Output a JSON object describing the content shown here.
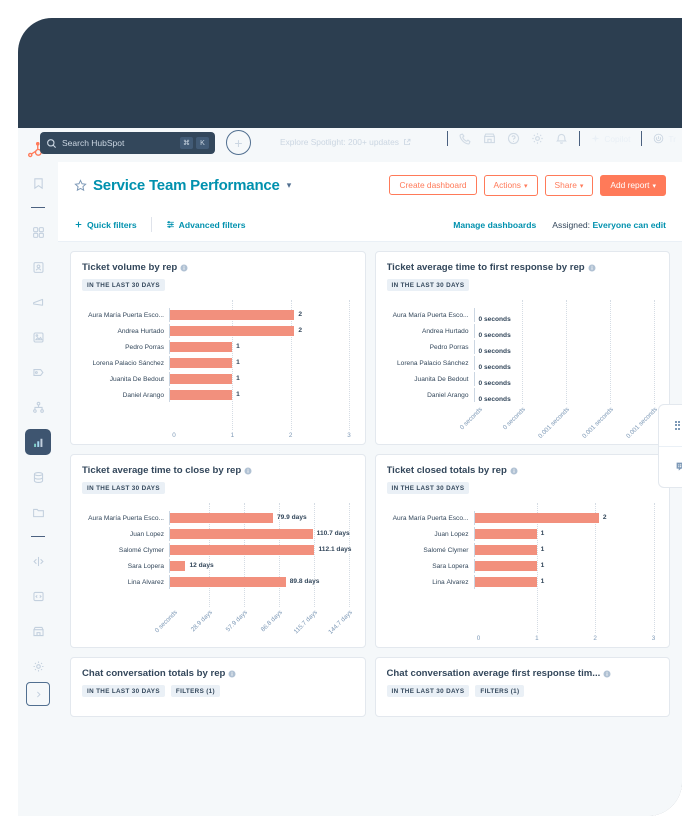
{
  "topnav": {
    "search_placeholder": "Search HubSpot",
    "search_icon": "search-icon",
    "kbd": [
      "⌘",
      "K"
    ],
    "plus_label": "+",
    "spotlight_text": "Explore Spotlight: 200+ updates",
    "external_icon": "external-link-icon",
    "icons": [
      "phone-icon",
      "marketplace-icon",
      "help-icon",
      "settings-icon",
      "notifications-icon"
    ],
    "copilot_label": "Copilot",
    "copilot_icon": "sparkle-icon",
    "account_label": "Tr",
    "account_icon": "account-icon"
  },
  "sidebar": {
    "logo": "hubspot-logo",
    "items": [
      {
        "name": "bookmarks",
        "icon": "bookmark-icon",
        "active": false
      },
      {
        "name": "workspaces",
        "icon": "grid-icon",
        "active": false
      },
      {
        "name": "contacts",
        "icon": "contacts-icon",
        "active": false
      },
      {
        "name": "marketing",
        "icon": "megaphone-icon",
        "active": false
      },
      {
        "name": "content",
        "icon": "content-icon",
        "active": false
      },
      {
        "name": "commerce",
        "icon": "tag-icon",
        "active": false
      },
      {
        "name": "automations",
        "icon": "workflow-icon",
        "active": false
      },
      {
        "name": "reporting",
        "icon": "bar-chart-icon",
        "active": true
      },
      {
        "name": "data-management",
        "icon": "database-icon",
        "active": false
      },
      {
        "name": "library",
        "icon": "folder-icon",
        "active": false
      },
      {
        "name": "integrations",
        "icon": "connect-icon",
        "active": false
      },
      {
        "name": "developer",
        "icon": "code-icon",
        "active": false
      },
      {
        "name": "app-marketplace",
        "icon": "marketplace-icon",
        "active": false
      },
      {
        "name": "settings",
        "icon": "gear-icon",
        "active": false
      }
    ],
    "expand_icon": "expand-right-icon"
  },
  "dashboard": {
    "title": "Service Team Performance",
    "star_icon": "star-outline-icon",
    "title_caret": "▾",
    "buttons": {
      "create": "Create dashboard",
      "actions": "Actions",
      "share": "Share",
      "add_report": "Add report",
      "caret": "▾"
    },
    "filters": {
      "quick": "Quick filters",
      "quick_icon": "plus-icon",
      "advanced": "Advanced filters",
      "advanced_icon": "filter-icon",
      "manage": "Manage dashboards",
      "assigned_label": "Assigned:",
      "assigned_value": "Everyone can edit"
    }
  },
  "chart_data": [
    {
      "type": "bar",
      "orientation": "horizontal",
      "title": "Ticket volume by rep",
      "badges": [
        "IN THE LAST 30 DAYS"
      ],
      "categories": [
        "Aura María Puerta Esco...",
        "Andrea Hurtado",
        "Pedro Porras",
        "Lorena Palacio Sánchez",
        "Juanita De Bedout",
        "Daniel Arango"
      ],
      "values": [
        2,
        2,
        1,
        1,
        1,
        1
      ],
      "value_labels": [
        "2",
        "2",
        "1",
        "1",
        "1",
        "1"
      ],
      "ticks": [
        "0",
        "1",
        "2",
        "3"
      ],
      "xlim": [
        0,
        3
      ],
      "grid": true,
      "bar_color": "#F2907D"
    },
    {
      "type": "bar",
      "orientation": "horizontal",
      "title": "Ticket average time to first response by rep",
      "badges": [
        "IN THE LAST 30 DAYS"
      ],
      "categories": [
        "Aura María Puerta Esco...",
        "Andrea Hurtado",
        "Pedro Porras",
        "Lorena Palacio Sánchez",
        "Juanita De Bedout",
        "Daniel Arango"
      ],
      "values": [
        0,
        0,
        0,
        0,
        0,
        0
      ],
      "value_labels": [
        "0 seconds",
        "0 seconds",
        "0 seconds",
        "0 seconds",
        "0 seconds",
        "0 seconds"
      ],
      "ticks": [
        "0 seconds",
        "0 seconds",
        "0.001 seconds",
        "0.001 seconds",
        "0.001 seconds"
      ],
      "xlim": [
        0,
        0.001
      ],
      "grid": true,
      "bar_color": "#F2907D"
    },
    {
      "type": "bar",
      "orientation": "horizontal",
      "title": "Ticket average time to close by rep",
      "badges": [
        "IN THE LAST 30 DAYS"
      ],
      "categories": [
        "Aura María Puerta Esco...",
        "Juan Lopez",
        "Salomé Clymer",
        "Sara Lopera",
        "Lina Álvarez"
      ],
      "values": [
        79.9,
        110.7,
        112.1,
        12,
        89.8
      ],
      "value_labels": [
        "79.9 days",
        "110.7 days",
        "112.1 days",
        "12 days",
        "89.8 days"
      ],
      "ticks": [
        "0 seconds",
        "28.9 days",
        "57.9 days",
        "86.8 days",
        "115.7 days",
        "144.7 days"
      ],
      "xlim": [
        0,
        144.7
      ],
      "grid": true,
      "bar_color": "#F2907D"
    },
    {
      "type": "bar",
      "orientation": "horizontal",
      "title": "Ticket closed totals by rep",
      "badges": [
        "IN THE LAST 30 DAYS"
      ],
      "categories": [
        "Aura María Puerta Esco...",
        "Juan Lopez",
        "Salomé Clymer",
        "Sara Lopera",
        "Lina Álvarez"
      ],
      "values": [
        2,
        1,
        1,
        1,
        1
      ],
      "value_labels": [
        "2",
        "1",
        "1",
        "1",
        "1"
      ],
      "ticks": [
        "0",
        "1",
        "2",
        "3"
      ],
      "xlim": [
        0,
        3
      ],
      "grid": true,
      "bar_color": "#F2907D"
    },
    {
      "type": "bar",
      "title": "Chat conversation totals by rep",
      "badges": [
        "IN THE LAST 30 DAYS",
        "FILTERS (1)"
      ],
      "categories": [],
      "values": []
    },
    {
      "type": "bar",
      "title": "Chat conversation average first response tim...",
      "badges": [
        "IN THE LAST 30 DAYS",
        "FILTERS (1)"
      ],
      "categories": [],
      "values": []
    }
  ],
  "side_widget": {
    "handle_icon": "drag-dots-icon",
    "chat_icon": "chat-bubble-icon"
  }
}
